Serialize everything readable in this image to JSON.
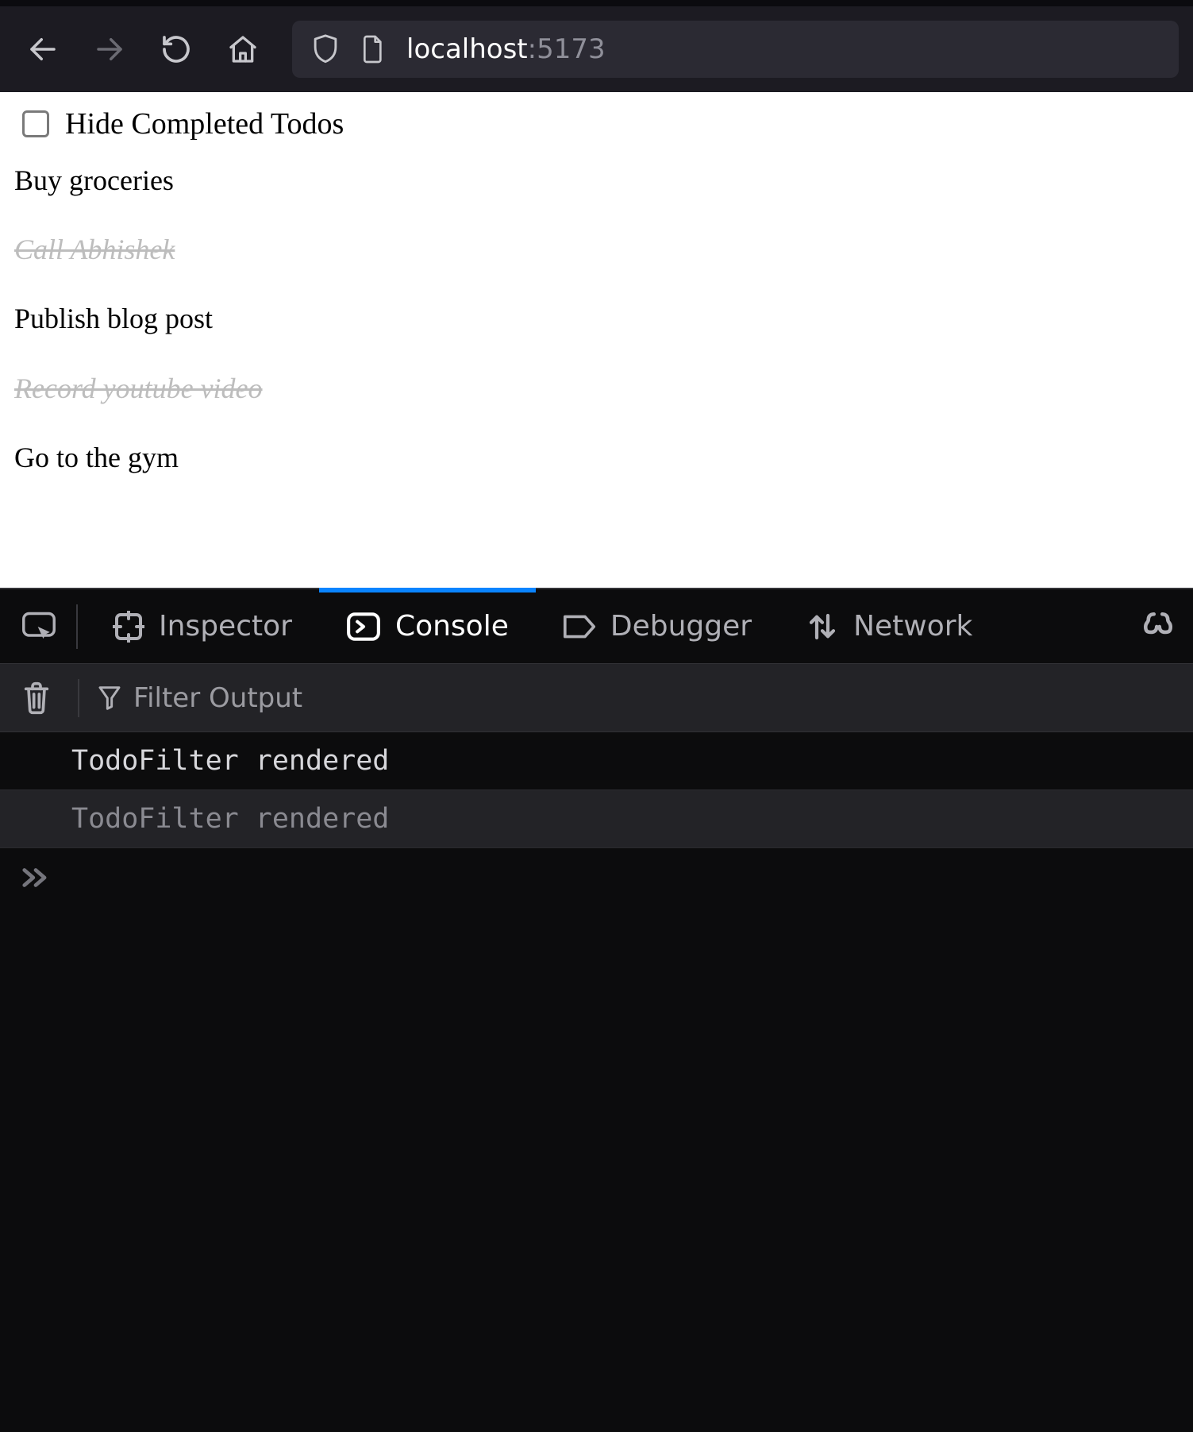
{
  "chrome": {
    "url_host": "localhost",
    "url_port": ":5173"
  },
  "page": {
    "filter_label": "Hide Completed Todos",
    "todos": [
      {
        "text": "Buy groceries",
        "done": false
      },
      {
        "text": "Call Abhishek",
        "done": true
      },
      {
        "text": "Publish blog post",
        "done": false
      },
      {
        "text": "Record youtube video",
        "done": true
      },
      {
        "text": "Go to the gym",
        "done": false
      }
    ]
  },
  "devtools": {
    "tabs": {
      "inspector": "Inspector",
      "console": "Console",
      "debugger": "Debugger",
      "network": "Network"
    },
    "active_tab": "console",
    "filter_placeholder": "Filter Output",
    "console": [
      {
        "text": "TodoFilter rendered",
        "dim": false
      },
      {
        "text": "TodoFilter rendered",
        "dim": true
      }
    ]
  }
}
